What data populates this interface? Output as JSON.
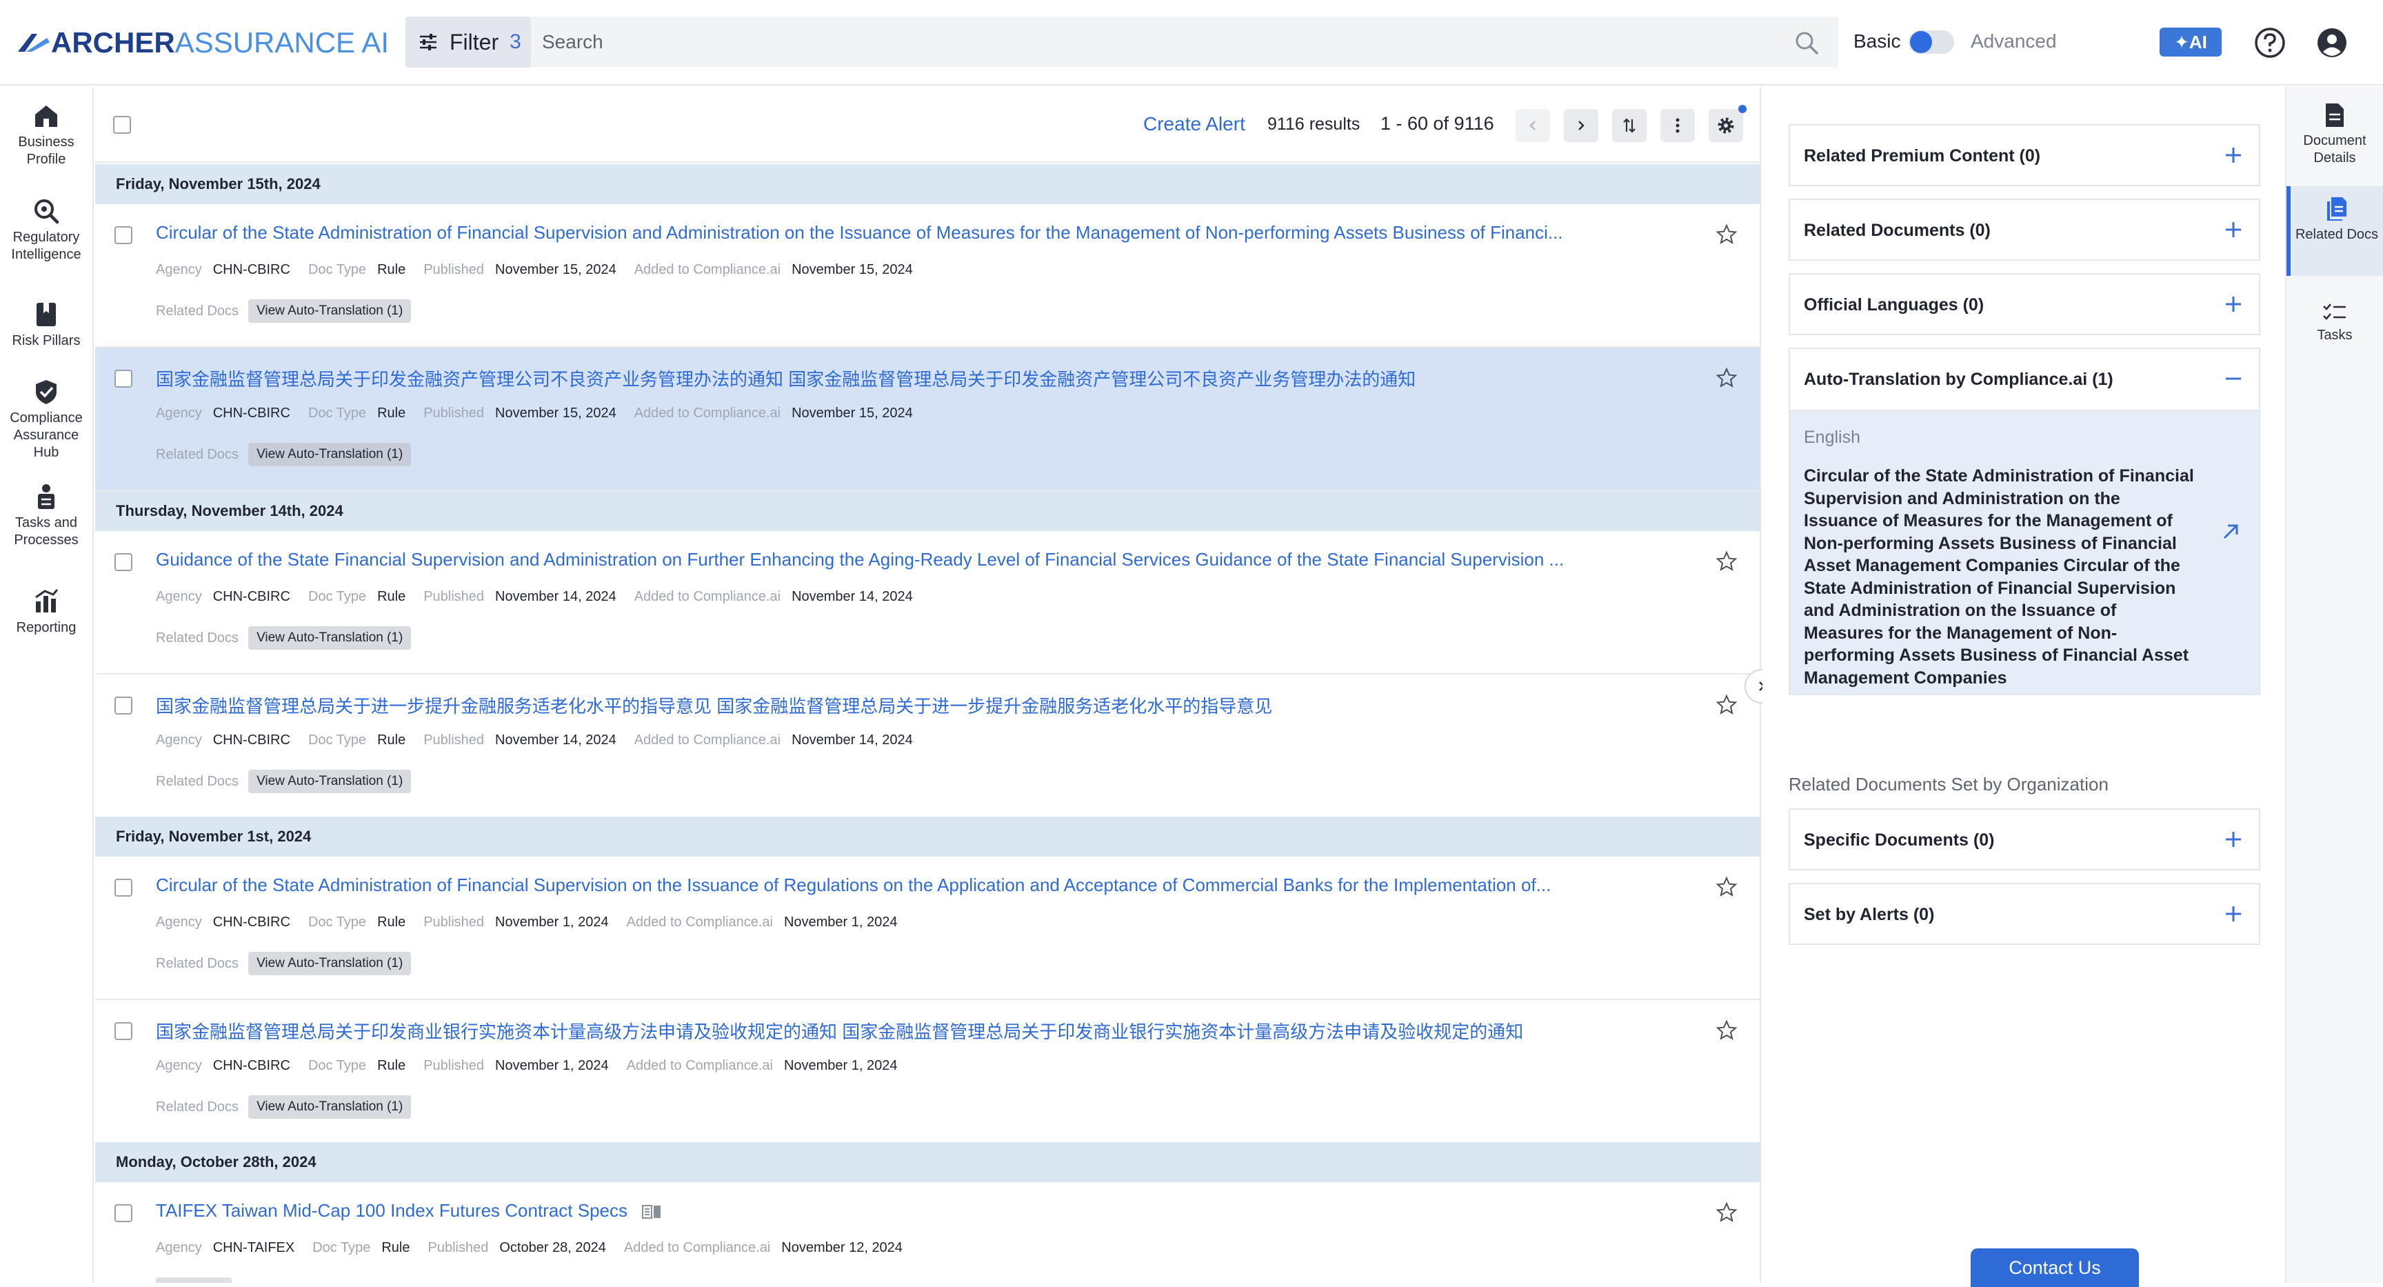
{
  "header": {
    "logo_primary": "ARCHER",
    "logo_secondary": "ASSURANCE AI",
    "filter_label": "Filter",
    "filter_count": "3",
    "search_placeholder": "Search",
    "mode_basic": "Basic",
    "mode_advanced": "Advanced",
    "ai_label": "AI"
  },
  "left_nav": [
    {
      "label": "Business Profile",
      "icon": "home-icon"
    },
    {
      "label": "Regulatory Intelligence",
      "icon": "search-icon"
    },
    {
      "label": "Risk Pillars",
      "icon": "bookmark-icon"
    },
    {
      "label": "Compliance Assurance Hub",
      "icon": "shield-check-icon"
    },
    {
      "label": "Tasks and Processes",
      "icon": "tasks-icon"
    },
    {
      "label": "Reporting",
      "icon": "chart-icon"
    }
  ],
  "toolbar": {
    "create_alert": "Create Alert",
    "result_count": "9116 results",
    "range": "1 - 60 of 9116"
  },
  "groups": [
    {
      "date": "Friday, November 15th, 2024",
      "docs": [
        {
          "title": "Circular of the State Administration of Financial Supervision and Administration on the Issuance of Measures for the Management of Non-performing Assets Business of Financi...",
          "agency": "CHN-CBIRC",
          "doc_type": "Rule",
          "published": "November 15, 2024",
          "added": "November 15, 2024",
          "translation": "View Auto-Translation (1)",
          "selected": false
        },
        {
          "title": "国家金融监督管理总局关于印发金融资产管理公司不良资产业务管理办法的通知 国家金融监督管理总局关于印发金融资产管理公司不良资产业务管理办法的通知",
          "agency": "CHN-CBIRC",
          "doc_type": "Rule",
          "published": "November 15, 2024",
          "added": "November 15, 2024",
          "translation": "View Auto-Translation (1)",
          "selected": true
        }
      ]
    },
    {
      "date": "Thursday, November 14th, 2024",
      "docs": [
        {
          "title": "Guidance of the State Financial Supervision and Administration on Further Enhancing the Aging-Ready Level of Financial Services Guidance of the State Financial Supervision ...",
          "agency": "CHN-CBIRC",
          "doc_type": "Rule",
          "published": "November 14, 2024",
          "added": "November 14, 2024",
          "translation": "View Auto-Translation (1)",
          "selected": false
        },
        {
          "title": "国家金融监督管理总局关于进一步提升金融服务适老化水平的指导意见 国家金融监督管理总局关于进一步提升金融服务适老化水平的指导意见",
          "agency": "CHN-CBIRC",
          "doc_type": "Rule",
          "published": "November 14, 2024",
          "added": "November 14, 2024",
          "translation": "View Auto-Translation (1)",
          "selected": false
        }
      ]
    },
    {
      "date": "Friday, November 1st, 2024",
      "docs": [
        {
          "title": "Circular of the State Administration of Financial Supervision on the Issuance of Regulations on the Application and Acceptance of Commercial Banks for the Implementation of...",
          "agency": "CHN-CBIRC",
          "doc_type": "Rule",
          "published": "November 1, 2024",
          "added": "November 1, 2024",
          "translation": "View Auto-Translation (1)",
          "selected": false
        },
        {
          "title": "国家金融监督管理总局关于印发商业银行实施资本计量高级方法申请及验收规定的通知 国家金融监督管理总局关于印发商业银行实施资本计量高级方法申请及验收规定的通知",
          "agency": "CHN-CBIRC",
          "doc_type": "Rule",
          "published": "November 1, 2024",
          "added": "November 1, 2024",
          "translation": "View Auto-Translation (1)",
          "selected": false
        }
      ]
    },
    {
      "date": "Monday, October 28th, 2024",
      "docs": [
        {
          "title": "TAIFEX Taiwan Mid-Cap 100 Index Futures Contract Specs",
          "agency": "CHN-TAIFEX",
          "doc_type": "Rule",
          "published": "October 28, 2024",
          "added": "November 12, 2024",
          "translation": "",
          "selected": false
        }
      ]
    }
  ],
  "meta_labels": {
    "agency": "Agency",
    "doc_type": "Doc Type",
    "published": "Published",
    "added": "Added to Compliance.ai",
    "related": "Related Docs"
  },
  "right_panel": {
    "cards_top": [
      "Related Premium Content (0)",
      "Related Documents (0)",
      "Official Languages (0)"
    ],
    "expanded": {
      "title": "Auto-Translation by Compliance.ai (1)",
      "language": "English",
      "translation": "Circular of the State Administration of Financial Supervision and Administration on the Issuance of Measures for the Management of Non-performing Assets Business of Financial Asset Management Companies Circular of the State Administration of Financial Supervision and Administration on the Issuance of Measures for the Management of Non-performing Assets Business of Financial Asset Management Companies"
    },
    "section_label": "Related Documents Set by Organization",
    "cards_bottom": [
      "Specific Documents (0)",
      "Set by Alerts (0)"
    ],
    "contact": "Contact Us"
  },
  "right_nav": [
    {
      "label": "Document Details",
      "icon": "document-icon",
      "active": false
    },
    {
      "label": "Related Docs",
      "icon": "related-docs-icon",
      "active": true
    },
    {
      "label": "Tasks",
      "icon": "checklist-icon",
      "active": false
    }
  ],
  "colors": {
    "accent": "#2f6bd6",
    "selected_row": "#d5e1f4",
    "date_header": "#dbe6f3",
    "logo_dark": "#1d3f8c",
    "logo_light": "#4a8fe6"
  }
}
